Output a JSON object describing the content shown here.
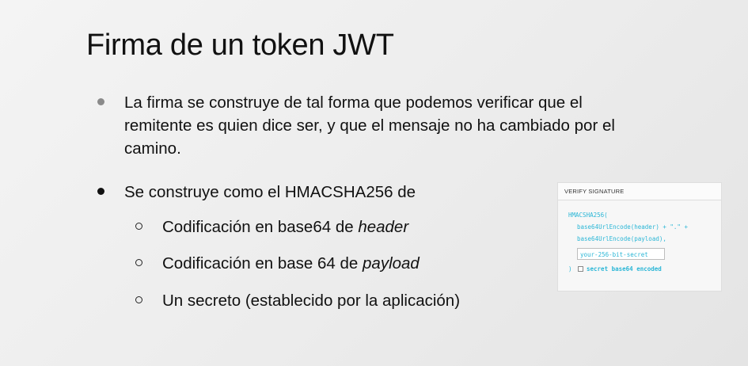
{
  "slide": {
    "title": "Firma de un token JWT",
    "bullet1": {
      "line1": "La firma se construye de tal forma que podemos verificar que el",
      "line2": "remitente es quien dice ser, y que el mensaje no ha cambiado por el",
      "line3": "camino."
    },
    "bullet2": "Se construye como el HMACSHA256 de",
    "sub_items": [
      {
        "text": "Codificación  en base64 de ",
        "emphasis": "header"
      },
      {
        "text": "Codificación  en base 64 de ",
        "emphasis": "payload"
      },
      {
        "text": "Un secreto (establecido por la aplicación)",
        "emphasis": ""
      }
    ]
  },
  "verify_panel": {
    "heading": "VERIFY SIGNATURE",
    "fn": "HMACSHA256(",
    "line_header": "base64UrlEncode(header) + \".\" +",
    "line_payload": "base64UrlEncode(payload),",
    "secret_value": "your-256-bit-secret",
    "close": ")",
    "checkbox_label": "secret base64 encoded",
    "accent_color": "#2ab6d6"
  }
}
